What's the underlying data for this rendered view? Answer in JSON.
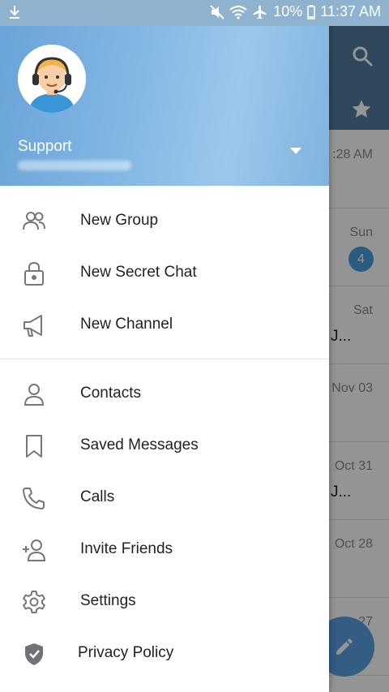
{
  "status_bar": {
    "battery": "10%",
    "time": "11:37 AM",
    "icons": [
      "download-icon",
      "mute-icon",
      "wifi-icon",
      "airplane-icon",
      "battery-icon"
    ]
  },
  "drawer": {
    "profile": {
      "name": "Support",
      "phone": "",
      "avatar_icon": "support-agent-avatar"
    },
    "menu_items": [
      {
        "label": "New Group",
        "icon": "group-icon"
      },
      {
        "label": "New Secret Chat",
        "icon": "lock-icon"
      },
      {
        "label": "New Channel",
        "icon": "megaphone-icon"
      },
      {
        "label": "Contacts",
        "icon": "person-icon"
      },
      {
        "label": "Saved Messages",
        "icon": "bookmark-icon"
      },
      {
        "label": "Calls",
        "icon": "phone-icon"
      },
      {
        "label": "Invite Friends",
        "icon": "add-person-icon"
      },
      {
        "label": "Settings",
        "icon": "gear-icon"
      },
      {
        "label": "Privacy Policy",
        "icon": "shield-check-icon"
      }
    ]
  },
  "background_chats": [
    {
      "date": ":28 AM",
      "snippet": ""
    },
    {
      "date": "Sun",
      "badge": "4",
      "snippet": ""
    },
    {
      "date": "Sat",
      "snippet": "J..."
    },
    {
      "date": "Nov 03",
      "snippet": ""
    },
    {
      "date": "Oct 31",
      "snippet": "J..."
    },
    {
      "date": "Oct 28",
      "snippet": ""
    },
    {
      "date": "27",
      "snippet": ""
    }
  ],
  "colors": {
    "header_bar": "#517da2",
    "drawer_header": "#82b7e3",
    "fab": "#5aa1e3",
    "badge": "#4a9fdb"
  }
}
